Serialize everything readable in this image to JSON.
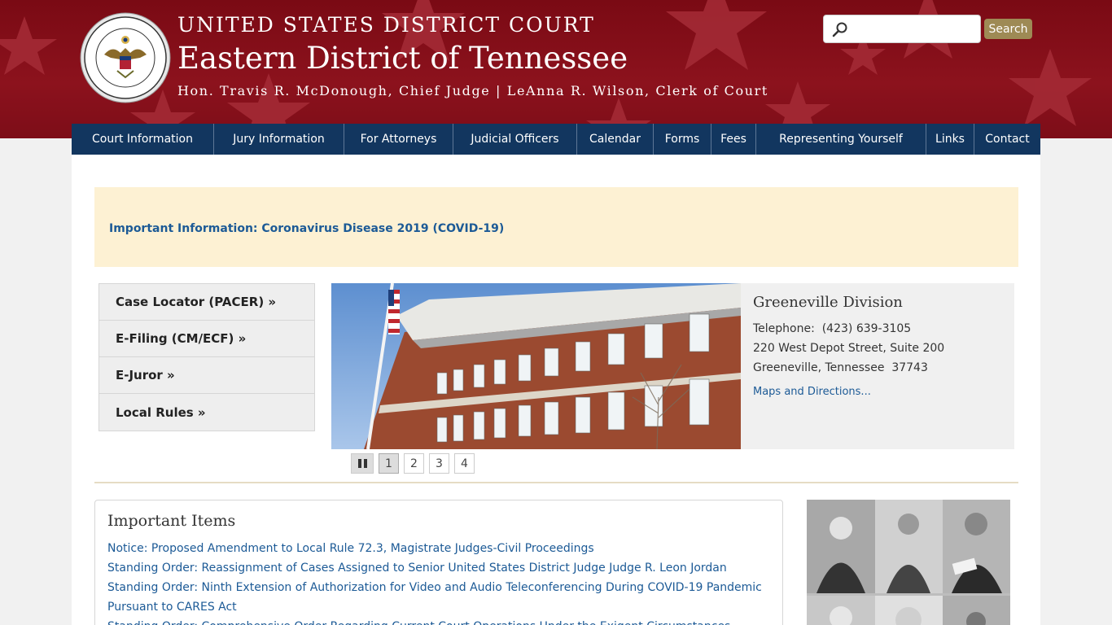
{
  "header": {
    "title_line1": "UNITED STATES DISTRICT COURT",
    "title_line2": "Eastern District of Tennessee",
    "title_line3": "Hon. Travis R. McDonough, Chief Judge | LeAnna R. Wilson, Clerk of Court",
    "search_placeholder": "",
    "search_button": "Search"
  },
  "nav": [
    {
      "label": "Court Information",
      "width": 175
    },
    {
      "label": "Jury Information",
      "width": 160
    },
    {
      "label": "For Attorneys",
      "width": 134
    },
    {
      "label": "Judicial Officers",
      "width": 152
    },
    {
      "label": "Calendar",
      "width": 94
    },
    {
      "label": "Forms",
      "width": 71
    },
    {
      "label": "Fees",
      "width": 55
    },
    {
      "label": "Representing Yourself",
      "width": 209
    },
    {
      "label": "Links",
      "width": 59
    },
    {
      "label": "Contact",
      "width": 81
    }
  ],
  "alert": {
    "link": "Important Information: Coronavirus Disease 2019 (COVID-19)"
  },
  "quick_links": [
    "Case Locator (PACER) »",
    "E-Filing (CM/ECF) »",
    "E-Juror »",
    "Local Rules »"
  ],
  "division": {
    "name": "Greeneville Division",
    "telephone": "Telephone:  (423) 639-3105",
    "address1": "220 West Depot Street, Suite 200",
    "address2": "Greeneville, Tennessee  37743",
    "maps_link": "Maps and Directions..."
  },
  "slideshow": {
    "pages": [
      "1",
      "2",
      "3",
      "4"
    ],
    "active": "1"
  },
  "important_items": {
    "heading": "Important Items",
    "items": [
      "Notice: Proposed Amendment to Local Rule 72.3, Magistrate Judges-Civil Proceedings",
      "Standing Order: Reassignment of Cases Assigned to Senior United States District Judge Judge R. Leon Jordan",
      "Standing Order: Ninth Extension of Authorization for Video and Audio Teleconferencing During COVID-19 Pandemic Pursuant to CARES Act",
      "Standing Order: Comprehensive Order Regarding Current Court Operations Under the Exigent Circumstances"
    ]
  },
  "colors": {
    "header_red": "#8c121d",
    "nav_blue": "#12365f",
    "link_blue": "#1c5a96",
    "alert_bg": "#fdf1d3",
    "search_btn": "#9e8a55"
  },
  "icons": [
    "search-icon",
    "court-seal-icon",
    "pause-icon"
  ]
}
